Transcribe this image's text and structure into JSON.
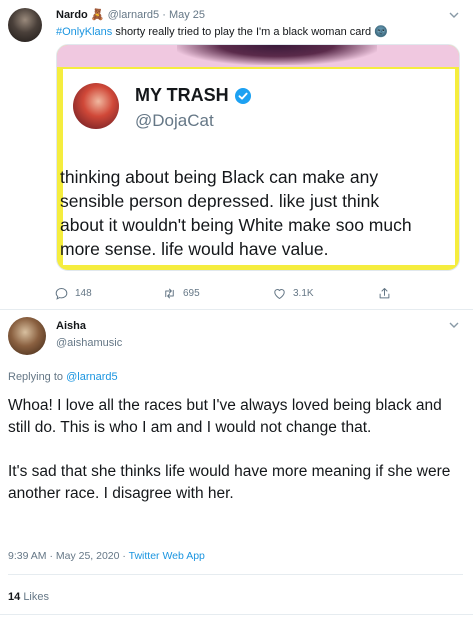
{
  "tweet1": {
    "author": "Nardo",
    "emoji": "🧸",
    "handle": "@larnard5",
    "dot": "·",
    "date": "May 25",
    "hashtag": "#OnlyKlans",
    "text": " shorty  really tried to play the I'm a black woman card",
    "text_emoji": "🌚",
    "actions": {
      "replies": "148",
      "retweets": "695",
      "likes": "3.1K"
    }
  },
  "embedded": {
    "name": "MY TRASH",
    "handle": "@DojaCat",
    "lines": [
      "thinking about being Black can make any",
      "sensible person depressed. like just think",
      "about it wouldn't being White make soo much",
      "more sense. life would have value."
    ]
  },
  "tweet2": {
    "author": "Aisha",
    "handle": "@aishamusic",
    "replying_prefix": "Replying to ",
    "replying_to": "@larnard5",
    "para1": "Whoa! I love all the races but I've always loved being black and still do. This is who I am and I would not change that.",
    "para2": "It's sad that she thinks life would have more meaning if she were another race. I disagree with her.",
    "time": "9:39 AM · May 25, 2020 · ",
    "source": "Twitter Web App",
    "likes_count": "14",
    "likes_label": "Likes"
  },
  "colors": {
    "accent": "#1b95e0",
    "verified": "#1da1f2",
    "frame": "#f5ed3e"
  }
}
